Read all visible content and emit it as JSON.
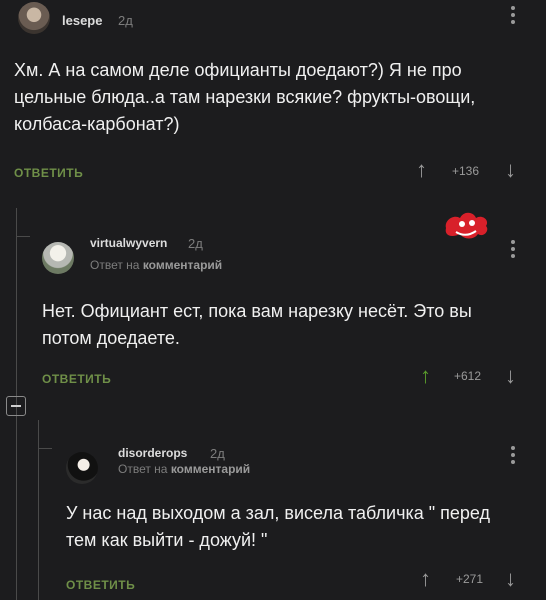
{
  "comments": [
    {
      "username": "lesepe",
      "time": "2д",
      "text": "Хм. А на самом деле официанты доедают?) Я не про цельные блюда..а там нарезки всякие? фрукты-овощи, колбаса-карбонат?)",
      "reply_label": "ОТВЕТИТЬ",
      "score": "+136"
    },
    {
      "username": "virtualwyvern",
      "time": "2д",
      "reply_to_prefix": "Ответ на",
      "reply_to_link": "комментарий",
      "text": "Нет. Официант ест, пока вам нарезку несёт. Это вы потом доедаете.",
      "reply_label": "ОТВЕТИТЬ",
      "score": "+612"
    },
    {
      "username": "disorderops",
      "time": "2д",
      "reply_to_prefix": "Ответ на",
      "reply_to_link": "комментарий",
      "text": "У нас над выходом а зал, висела табличка \" перед тем как выйти - дожуй! \"",
      "reply_label": "ОТВЕТИТЬ",
      "score": "+271"
    }
  ],
  "colors": {
    "background": "#1c1c1e",
    "reply_link": "#6f8f48",
    "upvoted_arrow": "#5a9d2c"
  },
  "icons": [
    "upvote-arrow-icon",
    "downvote-arrow-icon",
    "more-menu-icon",
    "collapse-thread-icon",
    "red-sticker-icon"
  ]
}
